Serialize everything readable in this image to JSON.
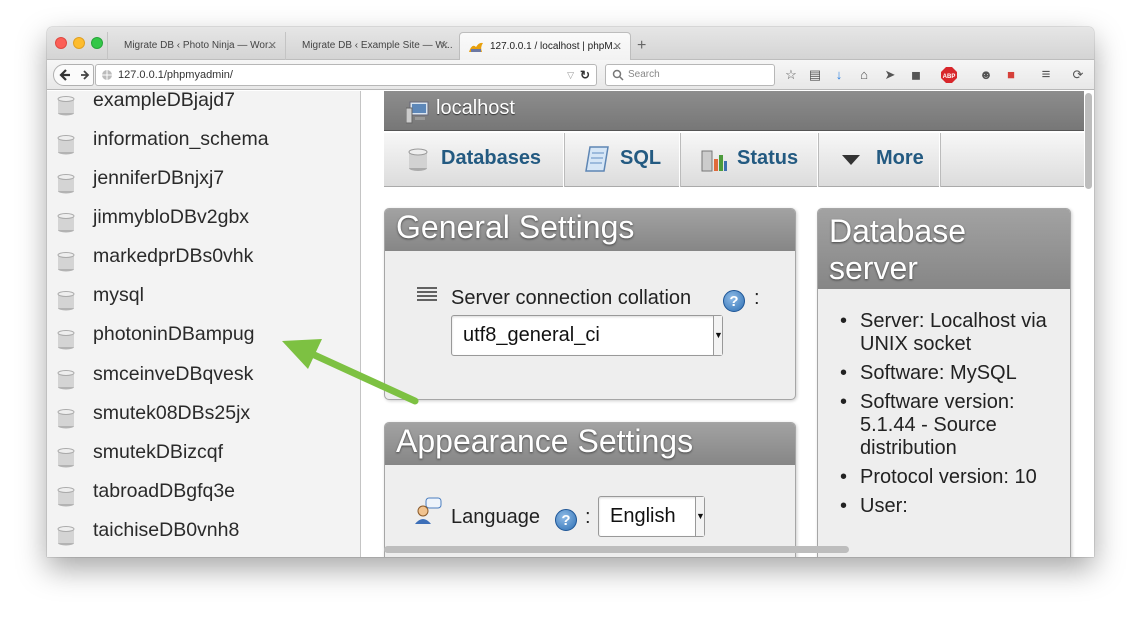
{
  "browser": {
    "tabs": [
      {
        "title": "Migrate DB ‹ Photo Ninja — Wor...",
        "close": "✕",
        "active": false
      },
      {
        "title": "Migrate DB ‹ Example Site — W...",
        "close": "✕",
        "active": false
      },
      {
        "title": "127.0.0.1 / localhost | phpM...",
        "close": "✕",
        "active": true
      }
    ],
    "new_tab": "+",
    "url": "127.0.0.1/phpmyadmin/",
    "search_placeholder": "Search"
  },
  "sidebar": {
    "databases": [
      "exampleDBjajd7",
      "information_schema",
      "jenniferDBnjxj7",
      "jimmybloDBv2gbx",
      "markedprDBs0vhk",
      "mysql",
      "photoninDBampug",
      "smceinveDBqvesk",
      "smutek08DBs25jx",
      "smutekDBizcqf",
      "tabroadDBgfq3e",
      "taichiseDB0vnh8"
    ]
  },
  "main": {
    "server_title": "localhost",
    "menu": [
      {
        "label": "Databases",
        "icon": "database-icon"
      },
      {
        "label": "SQL",
        "icon": "sql-scroll-icon"
      },
      {
        "label": "Status",
        "icon": "status-chart-icon"
      },
      {
        "label": "More",
        "icon": "triangle-down-icon"
      }
    ],
    "general_settings": {
      "title": "General Settings",
      "collation_label": "Server connection collation",
      "help": "?",
      "colon": ":",
      "collation_value": "utf8_general_ci"
    },
    "appearance_settings": {
      "title": "Appearance Settings",
      "language_label": "Language",
      "help": "?",
      "colon": ":",
      "language_value": "English"
    },
    "database_server": {
      "title_line1": "Database",
      "title_line2": "server",
      "items": [
        "Server: Localhost via UNIX socket",
        "Software: MySQL",
        "Software version: 5.1.44 - Source distribution",
        "Protocol version: 10",
        "User:"
      ]
    }
  },
  "annotation": {
    "color": "#7dc142",
    "points_to": "photoninDBampug"
  }
}
